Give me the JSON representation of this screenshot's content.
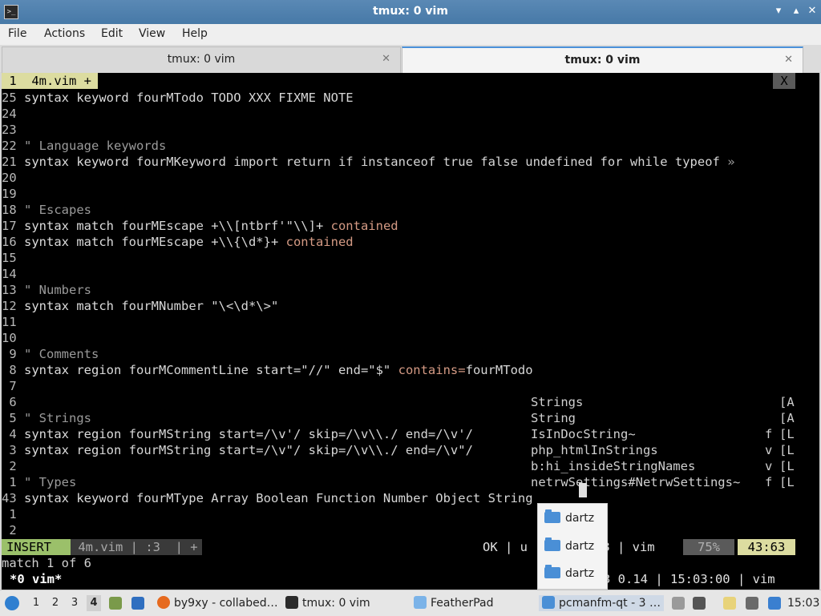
{
  "window": {
    "title": "tmux: 0 vim",
    "app_icon": "terminal-icon",
    "buttons": [
      "minimize-icon",
      "maximize-icon",
      "close-icon"
    ]
  },
  "menu": [
    "File",
    "Actions",
    "Edit",
    "View",
    "Help"
  ],
  "tabs": [
    {
      "label": "tmux: 0 vim",
      "active": false
    },
    {
      "label": "tmux: 0 vim",
      "active": true
    }
  ],
  "vim": {
    "tabline": " 1  4m.vim + ",
    "tabline_close": "X",
    "lines": [
      {
        "n": "25",
        "parts": [
          [
            "kw",
            "syntax keyword "
          ],
          [
            "t",
            "fourMTodo TODO XXX FIXME NOTE"
          ]
        ]
      },
      {
        "n": "24",
        "parts": []
      },
      {
        "n": "23",
        "parts": []
      },
      {
        "n": "22",
        "parts": [
          [
            "cm",
            "\" Language keywords"
          ]
        ]
      },
      {
        "n": "21",
        "parts": [
          [
            "kw",
            "syntax keyword "
          ],
          [
            "t",
            "fourMKeyword import return if instanceof true false undefined for while typeof "
          ],
          [
            "cm",
            "»"
          ]
        ]
      },
      {
        "n": "20",
        "parts": []
      },
      {
        "n": "19",
        "parts": []
      },
      {
        "n": "18",
        "parts": [
          [
            "cm",
            "\" Escapes"
          ]
        ]
      },
      {
        "n": "17",
        "parts": [
          [
            "kw",
            "syntax match "
          ],
          [
            "t",
            "fourMEscape +\\\\[ntbrf'\"\\\\]+ "
          ],
          [
            "ct",
            "contained"
          ]
        ]
      },
      {
        "n": "16",
        "parts": [
          [
            "kw",
            "syntax match "
          ],
          [
            "t",
            "fourMEscape +\\\\{\\d*}+ "
          ],
          [
            "ct",
            "contained"
          ]
        ]
      },
      {
        "n": "15",
        "parts": []
      },
      {
        "n": "14",
        "parts": []
      },
      {
        "n": "13",
        "parts": [
          [
            "cm",
            "\" Numbers"
          ]
        ]
      },
      {
        "n": "12",
        "parts": [
          [
            "kw",
            "syntax match "
          ],
          [
            "t",
            "fourMNumber \"\\<\\d*\\>\""
          ]
        ]
      },
      {
        "n": "11",
        "parts": []
      },
      {
        "n": "10",
        "parts": []
      },
      {
        "n": " 9",
        "parts": [
          [
            "cm",
            "\" Comments"
          ]
        ]
      },
      {
        "n": " 8",
        "parts": [
          [
            "kw",
            "syntax region "
          ],
          [
            "t",
            "fourMCommentLine start=\"//\" end=\"$\" "
          ],
          [
            "ct",
            "contains="
          ],
          [
            "t",
            "fourMTodo"
          ]
        ]
      },
      {
        "n": " 7",
        "parts": []
      },
      {
        "n": " 6",
        "parts": []
      },
      {
        "n": " 5",
        "parts": [
          [
            "cm",
            "\" Strings"
          ]
        ]
      },
      {
        "n": " 4",
        "parts": [
          [
            "kw",
            "syntax region "
          ],
          [
            "t",
            "fourMString start=/\\v'/ skip=/\\v\\\\./ end=/\\v'/"
          ]
        ]
      },
      {
        "n": " 3",
        "parts": [
          [
            "kw",
            "syntax region "
          ],
          [
            "t",
            "fourMString start=/\\v\"/ skip=/\\v\\\\./ end=/\\v\"/"
          ]
        ]
      },
      {
        "n": " 2",
        "parts": []
      },
      {
        "n": " 1",
        "parts": [
          [
            "cm",
            "\" Types"
          ]
        ]
      },
      {
        "n": "43",
        "parts": [
          [
            "kw",
            "syntax keyword "
          ],
          [
            "t",
            "fourMType Array Boolean Function Number Object String"
          ]
        ]
      },
      {
        "n": " 1",
        "parts": []
      },
      {
        "n": " 2",
        "parts": []
      }
    ],
    "popup_menu": [
      {
        "word": "Strings",
        "kind": "",
        "menu": "[A"
      },
      {
        "word": "String",
        "kind": "",
        "menu": "[A"
      },
      {
        "word": "IsInDocString~",
        "kind": "f",
        "menu": "[L"
      },
      {
        "word": "php_htmlInStrings",
        "kind": "v",
        "menu": "[L"
      },
      {
        "word": "b:hi_insideStringNames",
        "kind": "v",
        "menu": "[L"
      },
      {
        "word": "netrwSettings#NetrwSettings~",
        "kind": "f",
        "menu": "[L"
      }
    ],
    "statusline": {
      "mode": "INSERT",
      "file": " 4m.vim | :3  | + ",
      "middle": "OK | u        f-8 | vim ",
      "percent": "75%",
      "position": "43:63"
    },
    "message": "match 1 of 6"
  },
  "tmux": {
    "left": "*0 vim*",
    "right": "3 0.14 | 15:03:00 | vim"
  },
  "file_popup": {
    "items": [
      "dartz",
      "dartz",
      "dartz"
    ],
    "icon": "folder-icon"
  },
  "taskbar": {
    "start_icon": "start-menu-icon",
    "workspaces": [
      "1",
      "2",
      "3",
      "4"
    ],
    "active_workspace": "4",
    "tasks": [
      {
        "label": "by9xy - collabed…",
        "icon": "firefox-icon"
      },
      {
        "label": "tmux: 0 vim",
        "icon": "terminal-icon"
      },
      {
        "label": "FeatherPad",
        "icon": "text-editor-icon"
      },
      {
        "label": "pcmanfm-qt - 3 …",
        "icon": "folder-icon"
      }
    ],
    "clock": "15:03",
    "colors": {
      "accent": "#4a90d9",
      "insert": "#9bc06a",
      "position": "#dcdca0"
    }
  }
}
